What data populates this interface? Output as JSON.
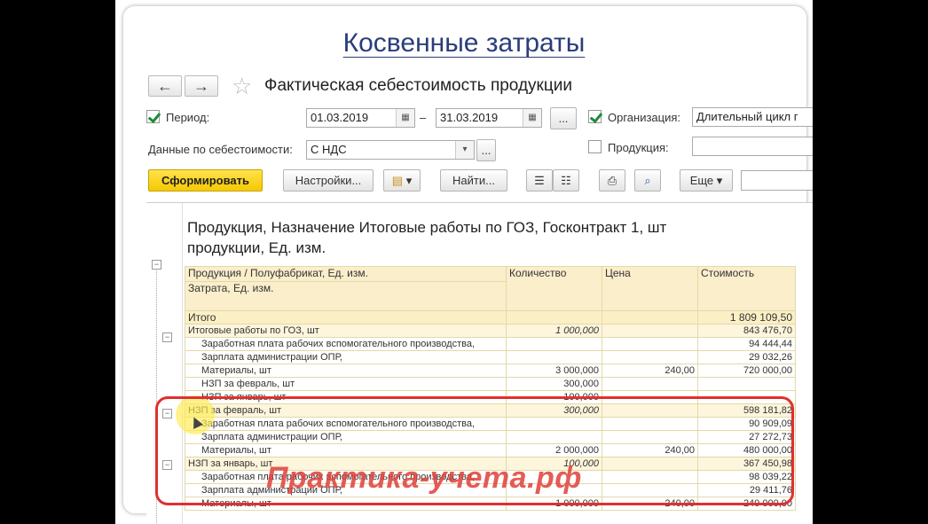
{
  "slide": {
    "title": "Косвенные затраты"
  },
  "form": {
    "title": "Фактическая себестоимость продукции",
    "back_icon": "←",
    "forward_icon": "→",
    "star_icon": "☆",
    "period_label": "Период:",
    "period_from": "01.03.2019",
    "period_to": "31.03.2019",
    "dash": "–",
    "ellipsis": "...",
    "org_label": "Организация:",
    "org_value": "Длительный цикл г",
    "cost_data_label": "Данные по себестоимости:",
    "cost_data_value": "С НДС",
    "dropdown_icon": "▾",
    "product_label": "Продукция:"
  },
  "toolbar": {
    "generate": "Сформировать",
    "settings": "Настройки...",
    "find": "Найти...",
    "more": "Еще ▾",
    "caret": "▾"
  },
  "report": {
    "heading_line1": "Продукция, Назначение  Итоговые работы по ГОЗ, Госконтракт 1, шт",
    "heading_line2": "продукции, Ед. изм.",
    "columns": {
      "product": "Продукция / Полуфабрикат, Ед. изм.",
      "cost_item": "Затрата, Ед. изм.",
      "qty": "Количество",
      "price": "Цена",
      "cost": "Стоимость"
    },
    "total": {
      "label": "Итого",
      "cost": "1 809 109,50"
    },
    "rows": [
      {
        "name": "Итоговые работы по ГОЗ, шт",
        "qty": "1 000,000",
        "price": "",
        "cost": "843 476,70",
        "type": "group"
      },
      {
        "name": "Заработная плата рабочих вспомогательного производства,",
        "qty": "",
        "price": "",
        "cost": "94 444,44",
        "type": "item"
      },
      {
        "name": "Зарплата администрации ОПР,",
        "qty": "",
        "price": "",
        "cost": "29 032,26",
        "type": "item"
      },
      {
        "name": "Материалы, шт",
        "qty": "3 000,000",
        "price": "240,00",
        "cost": "720 000,00",
        "type": "item"
      },
      {
        "name": "НЗП за февраль, шт",
        "qty": "300,000",
        "price": "",
        "cost": "",
        "type": "item"
      },
      {
        "name": "НЗП за январь, шт",
        "qty": "100,000",
        "price": "",
        "cost": "",
        "type": "item"
      },
      {
        "name": "НЗП за февраль, шт",
        "qty": "300,000",
        "price": "",
        "cost": "598 181,82",
        "type": "group"
      },
      {
        "name": "Заработная плата рабочих вспомогательного производства,",
        "qty": "",
        "price": "",
        "cost": "90 909,09",
        "type": "item"
      },
      {
        "name": "Зарплата администрации ОПР,",
        "qty": "",
        "price": "",
        "cost": "27 272,73",
        "type": "item"
      },
      {
        "name": "Материалы, шт",
        "qty": "2 000,000",
        "price": "240,00",
        "cost": "480 000,00",
        "type": "item"
      },
      {
        "name": "НЗП за январь, шт",
        "qty": "100,000",
        "price": "",
        "cost": "367 450,98",
        "type": "group"
      },
      {
        "name": "Заработная плата рабочих вспомогательного производства,",
        "qty": "",
        "price": "",
        "cost": "98 039,22",
        "type": "item"
      },
      {
        "name": "Зарплата администрации ОПР,",
        "qty": "",
        "price": "",
        "cost": "29 411,76",
        "type": "item"
      },
      {
        "name": "Материалы, шт",
        "qty": "1 000,000",
        "price": "240,00",
        "cost": "240 000,00",
        "type": "item"
      }
    ]
  },
  "watermark": "Практика-учета.рф",
  "colors": {
    "accent_yellow": "#f5c800",
    "highlight_red": "#e03030",
    "title_blue": "#2a3d7a"
  }
}
